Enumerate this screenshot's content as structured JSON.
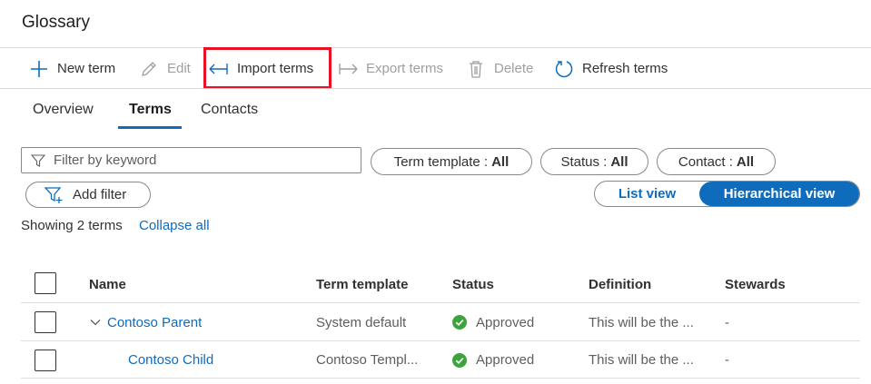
{
  "page": {
    "title": "Glossary"
  },
  "toolbar": {
    "new_term": "New term",
    "edit": "Edit",
    "import_terms": "Import terms",
    "export_terms": "Export terms",
    "delete": "Delete",
    "refresh_terms": "Refresh terms"
  },
  "tabs": [
    {
      "label": "Overview",
      "active": false
    },
    {
      "label": "Terms",
      "active": true
    },
    {
      "label": "Contacts",
      "active": false
    }
  ],
  "filters": {
    "keyword_placeholder": "Filter by keyword",
    "term_template_label": "Term template :",
    "term_template_value": "All",
    "status_label": "Status :",
    "status_value": "All",
    "contact_label": "Contact :",
    "contact_value": "All",
    "add_filter": "Add filter"
  },
  "view_toggle": {
    "list_view": "List view",
    "hierarchical_view": "Hierarchical view",
    "selected": "Hierarchical view"
  },
  "summary": {
    "showing": "Showing 2 terms",
    "collapse_all": "Collapse all"
  },
  "table": {
    "columns": [
      "Name",
      "Term template",
      "Status",
      "Definition",
      "Stewards"
    ],
    "rows": [
      {
        "name": "Contoso Parent",
        "term_template": "System default",
        "status": "Approved",
        "definition": "This will be the ...",
        "stewards": "-"
      },
      {
        "name": "Contoso Child",
        "term_template": "Contoso Templ...",
        "status": "Approved",
        "definition": "This will be the ...",
        "stewards": "-"
      }
    ]
  },
  "colors": {
    "accent": "#0f6cbd",
    "highlight": "#e81123",
    "approved": "#3da33d"
  },
  "icons": {
    "new_term": "plus-icon",
    "edit": "pencil-icon",
    "import_terms": "import-arrow-icon",
    "export_terms": "export-arrow-icon",
    "delete": "trash-icon",
    "refresh_terms": "refresh-icon",
    "filter": "funnel-icon",
    "add_filter": "funnel-plus-icon",
    "status_approved": "check-circle-icon",
    "expand": "chevron-down-icon"
  }
}
